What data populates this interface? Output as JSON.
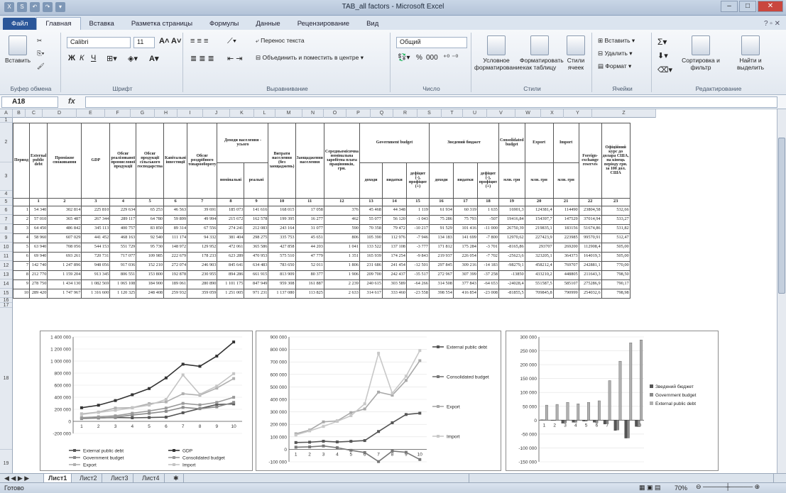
{
  "window": {
    "title": "TAB_all factors - Microsoft Excel",
    "controls": [
      "–",
      "□",
      "✕"
    ]
  },
  "qat": [
    "X",
    "S",
    "↶",
    "↷",
    "▾"
  ],
  "tabs": [
    "Файл",
    "Главная",
    "Вставка",
    "Разметка страницы",
    "Формулы",
    "Данные",
    "Рецензирование",
    "Вид"
  ],
  "ribbon": {
    "clipboard": {
      "paste": "Вставить",
      "label": "Буфер обмена"
    },
    "font": {
      "name": "Calibri",
      "size": "11",
      "label": "Шрифт",
      "bold": "Ж",
      "italic": "К",
      "underline": "Ч"
    },
    "alignment": {
      "wrap": "Перенос текста",
      "merge": "Объединить и поместить в центре",
      "label": "Выравнивание"
    },
    "number": {
      "format": "Общий",
      "percent": "%",
      "thousands": "000",
      "label": "Число"
    },
    "styles": {
      "conditional": "Условное форматирование",
      "as_table": "Форматировать как таблицу",
      "cell_styles": "Стили ячеек",
      "label": "Стили"
    },
    "cells": {
      "insert": "Вставить",
      "delete": "Удалить",
      "format": "Формат",
      "label": "Ячейки"
    },
    "editing": {
      "sort": "Сортировка и фильтр",
      "find": "Найти и выделить",
      "label": "Редактирование"
    }
  },
  "formula_bar": {
    "cell": "A18",
    "fx": "fx",
    "value": ""
  },
  "columns": [
    "A",
    "B",
    "C",
    "D",
    "E",
    "F",
    "G",
    "H",
    "I",
    "J",
    "K",
    "L",
    "M",
    "N",
    "O",
    "P",
    "Q",
    "R",
    "S",
    "T",
    "U",
    "V",
    "W",
    "X",
    "Y",
    "Z"
  ],
  "rows": [
    "1",
    "2",
    "3",
    "4",
    "5",
    "6",
    "7",
    "8",
    "9",
    "10",
    "11",
    "12",
    "13",
    "14",
    "15",
    "16",
    "17",
    "18",
    "19"
  ],
  "table": {
    "headers": {
      "period": "Период",
      "ext_debt": "External public debt",
      "consumption": "Проміжне споживання",
      "gdp": "GDP",
      "industrial": "Обсяг реалізованої промислової продукції",
      "agri": "Обсяг продукції сільського господарства",
      "capital": "Капітальні інвестиції",
      "retail": "Обсяг роздрібного товарообороту",
      "income": "Доходи населення - усього",
      "income_nom": "номінальні",
      "income_real": "реальні",
      "expenses": "Витрати населення (без заощаджень)",
      "savings": "Заощадження населення",
      "wage": "Середньомісячна номінальна заробітна плата працівників, грн.",
      "gov_budget": "Government budget",
      "gov_rev": "доходи",
      "gov_exp": "видатки",
      "gov_def": "дефіцит (-), профіцит (+)",
      "ext_budget": "Зведений бюджет",
      "ext_rev": "доходи",
      "ext_exp": "видатки",
      "ext_def": "дефіцит (-), профіцит (+)",
      "cons_budget": "Consolidated budget",
      "export": "Export",
      "import": "Import",
      "units_mln": "млн. грн",
      "fx_reserves": "Foreign-exchange reserves",
      "rate": "Офіційний курс до долара США, на кінець періоду грн. за 100 дол. США"
    },
    "index_row": [
      "",
      "1",
      "2",
      "3",
      "4",
      "5",
      "6",
      "7",
      "8",
      "9",
      "10",
      "11",
      "12",
      "13",
      "14",
      "15",
      "16",
      "17",
      "18",
      "19",
      "20",
      "21",
      "22",
      "23"
    ],
    "rows": [
      [
        "1",
        "54 340",
        "302 814",
        "225 810",
        "229 634",
        "65 253",
        "46 563",
        "39 691",
        "185 073",
        "141 616",
        "168 015",
        "17 058",
        "376",
        "45 468",
        "44 348",
        "1 119",
        "61 934",
        "60 319",
        "1 635",
        "16901,3",
        "124381,4",
        "114490",
        "23804,58",
        "532,66"
      ],
      [
        "2",
        "57 010",
        "365 487",
        "267 344",
        "289 117",
        "64 780",
        "59 899",
        "49 994",
        "215 672",
        "162 578",
        "199 395",
        "16 277",
        "462",
        "55 077",
        "56 120",
        "-1 043",
        "75 286",
        "75 793",
        "-507",
        "19416,84",
        "154397,7",
        "147529",
        "37014,94",
        "533,27"
      ],
      [
        "3",
        "64 450",
        "486 842",
        "345 113",
        "400 757",
        "83 850",
        "89 314",
        "67 556",
        "274 241",
        "212 083",
        "243 164",
        "31 077",
        "590",
        "70 358",
        "79 472",
        "-10 217",
        "91 529",
        "101 416",
        "-11 000",
        "26750,39",
        "219835,1",
        "183156",
        "51674,86",
        "531,82"
      ],
      [
        "4",
        "58 960",
        "607 029",
        "441 452",
        "468 163",
        "92 540",
        "111 174",
        "94 332",
        "381 404",
        "298 275",
        "335 753",
        "45 651",
        "806",
        "105 390",
        "112 976",
        "-7 946",
        "134 183",
        "141 699",
        "-7 800",
        "12970,62",
        "227423,9",
        "223985",
        "99570,91",
        "512,47"
      ],
      [
        "5",
        "63 940",
        "708 056",
        "544 153",
        "551 729",
        "95 730",
        "148 972",
        "129 952",
        "472 061",
        "365 586",
        "427 858",
        "44 203",
        "1 041",
        "133 522",
        "137 108",
        "-3 777",
        "171 812",
        "175 284",
        "-3 701",
        "-8165,86",
        "293707",
        "269200",
        "112908,4",
        "505,00"
      ],
      [
        "6",
        "69 940",
        "693 261",
        "720 731",
        "717 077",
        "109 985",
        "222 679",
        "178 233",
        "623 289",
        "470 953",
        "575 510",
        "47 779",
        "1 351",
        "165 939",
        "174 254",
        "-9 843",
        "219 937",
        "226 054",
        "-7 702",
        "-25623,6",
        "323205,1",
        "364373",
        "164019,3",
        "505,00"
      ],
      [
        "7",
        "142 740",
        "1 247 896",
        "948 056",
        "917 036",
        "152 210",
        "272 074",
        "246 903",
        "845 641",
        "634 483",
        "783 650",
        "52 011",
        "1 806",
        "231 686",
        "241 454",
        "-12 501",
        "297 845",
        "309 216",
        "-14 183",
        "-98279,1",
        "458212,4",
        "769707",
        "242881,1",
        "770,00"
      ],
      [
        "8",
        "212 770",
        "1 159 204",
        "913 345",
        "806 551",
        "153 800",
        "192 878",
        "230 955",
        "894 286",
        "661 915",
        "813 909",
        "80 377",
        "1 906",
        "209 700",
        "242 437",
        "-35 517",
        "272 967",
        "307 399",
        "-37 258",
        "-13850",
        "433210,2",
        "448805",
        "211643,3",
        "798,50"
      ],
      [
        "9",
        "278 750",
        "1 434 130",
        "1 082 569",
        "1 065 108",
        "184 900",
        "189 061",
        "280 890",
        "1 101 175",
        "847 949",
        "959 308",
        "161 887",
        "2 239",
        "240 615",
        "303 589",
        "-64 266",
        "314 508",
        "377 843",
        "-64 653",
        "-24028,4",
        "551587,5",
        "585107",
        "275286,9",
        "790,17"
      ],
      [
        "10",
        "289 420",
        "1 747 967",
        "1 316 600",
        "1 120 325",
        "248 408",
        "259 932",
        "359 059",
        "1 251 005",
        "971 231",
        "1 137 080",
        "113 825",
        "2 633",
        "314 617",
        "333 460",
        "-23 558",
        "398 554",
        "416 854",
        "-23 008",
        "-81855,5",
        "709845,8",
        "790999",
        "254032,6",
        "798,98"
      ]
    ]
  },
  "chart_data": [
    {
      "type": "line",
      "x": [
        "1",
        "2",
        "3",
        "4",
        "5",
        "6",
        "7",
        "8",
        "9",
        "10"
      ],
      "ylim": [
        -200000,
        1400000
      ],
      "yticks": [
        "1 400 000",
        "1 200 000",
        "1 000 000",
        "800 000",
        "600 000",
        "400 000",
        "200 000",
        "0",
        "-200 000"
      ],
      "series": [
        {
          "name": "External public debt",
          "color": "#555555",
          "values": [
            54340,
            57010,
            64450,
            58960,
            63940,
            69940,
            142740,
            212770,
            278750,
            289420
          ]
        },
        {
          "name": "Government budget",
          "color": "#8a8a8a",
          "values": [
            45468,
            55077,
            70358,
            105390,
            133522,
            165939,
            231686,
            209700,
            240615,
            314617
          ]
        },
        {
          "name": "Export",
          "color": "#b0b0b0",
          "values": [
            124381,
            154398,
            219835,
            227424,
            293707,
            323205,
            458212,
            433210,
            551588,
            709846
          ]
        },
        {
          "name": "GDP",
          "color": "#333333",
          "values": [
            225810,
            267344,
            345113,
            441452,
            544153,
            720731,
            948056,
            913345,
            1082569,
            1316600
          ]
        },
        {
          "name": "Consolidated budget",
          "color": "#9a9a9a",
          "values": [
            61934,
            75286,
            91529,
            134183,
            171812,
            219937,
            297845,
            272967,
            314508,
            398554
          ]
        },
        {
          "name": "Import",
          "color": "#c4c4c4",
          "values": [
            114490,
            147529,
            183156,
            223985,
            269200,
            364373,
            769707,
            448805,
            585107,
            790999
          ]
        }
      ]
    },
    {
      "type": "line",
      "x": [
        "1",
        "2",
        "3",
        "4",
        "5",
        "6",
        "7",
        "8",
        "9",
        "10"
      ],
      "ylim": [
        -100000,
        900000
      ],
      "yticks": [
        "900 000",
        "800 000",
        "700 000",
        "600 000",
        "500 000",
        "400 000",
        "300 000",
        "200 000",
        "100 000",
        "0",
        "-100 000"
      ],
      "series": [
        {
          "name": "External public debt",
          "color": "#555555",
          "values": [
            54340,
            57010,
            64450,
            58960,
            63940,
            69940,
            142740,
            212770,
            278750,
            289420
          ]
        },
        {
          "name": "Consolidated budget",
          "color": "#777777",
          "values": [
            16901,
            19417,
            26750,
            12971,
            -8166,
            -25624,
            -98279,
            -13850,
            -24028,
            -81856
          ]
        },
        {
          "name": "Export",
          "color": "#a8a8a8",
          "values": [
            124381,
            154398,
            219835,
            227424,
            293707,
            323205,
            458212,
            433210,
            551588,
            709846
          ]
        },
        {
          "name": "Import",
          "color": "#c8c8c8",
          "values": [
            114490,
            147529,
            183156,
            223985,
            269200,
            364373,
            769707,
            448805,
            585107,
            790999
          ]
        }
      ]
    },
    {
      "type": "bar",
      "categories": [
        "1",
        "2",
        "3",
        "4",
        "5",
        "6",
        "7",
        "8",
        "9",
        "10"
      ],
      "ylim": [
        -150000,
        300000
      ],
      "yticks": [
        "300 000",
        "250 000",
        "200 000",
        "150 000",
        "100 000",
        "50 000",
        "0",
        "-50 000",
        "-100 000",
        "-150 000"
      ],
      "series": [
        {
          "name": "Зведений бюджет",
          "color": "#555555",
          "values": [
            1635,
            -507,
            -11000,
            -7800,
            -3701,
            -7702,
            -14183,
            -37258,
            -64653,
            -23008
          ]
        },
        {
          "name": "Government budget",
          "color": "#8a8a8a",
          "values": [
            1119,
            -1043,
            -10217,
            -7946,
            -3777,
            -9843,
            -12501,
            -35517,
            -64266,
            -23558
          ]
        },
        {
          "name": "External public debt",
          "color": "#b0b0b0",
          "values": [
            54340,
            57010,
            64450,
            58960,
            63940,
            69940,
            142740,
            212770,
            278750,
            289420
          ]
        }
      ]
    }
  ],
  "sheets": [
    "Лист1",
    "Лист2",
    "Лист3",
    "Лист4"
  ],
  "status": {
    "ready": "Готово",
    "zoom": "70%"
  }
}
